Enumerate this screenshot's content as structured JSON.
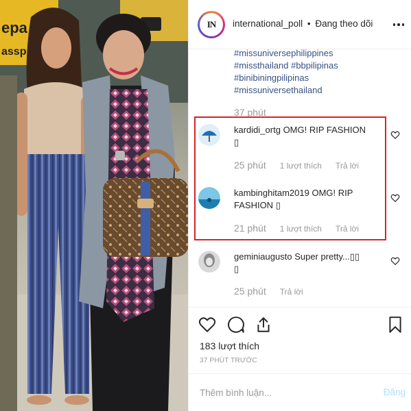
{
  "header": {
    "avatar_text": "IN",
    "username": "international_poll",
    "separator": "•",
    "follow_status": "Đang theo dõi",
    "more_icon": "more-horizontal-icon"
  },
  "caption": {
    "hashtags": [
      "#missuniversephilippines",
      "#missthailand #bbpilipinas",
      "#binibiningpilipinas",
      "#missuniversethailand"
    ],
    "time": "37 phút"
  },
  "comments": [
    {
      "username": "kardidi_ortg",
      "text": "OMG! RIP FASHION",
      "emoji_placeholder": "▯",
      "time": "25 phút",
      "likes": "1 lượt thích",
      "reply": "Trả lời",
      "avatar_color": "#1f6fb5"
    },
    {
      "username": "kambinghitam2019",
      "text": "OMG! RIP FASHION",
      "emoji_placeholder": "▯",
      "time": "21 phút",
      "likes": "1 lượt thích",
      "reply": "Trả lời",
      "avatar_color": "#3aa3d1"
    },
    {
      "username": "geminiaugusto",
      "text": "Super pretty...▯▯",
      "emoji_placeholder": "▯",
      "time": "25 phút",
      "likes": "",
      "reply": "Trả lời",
      "avatar_color": "#8a8a8a"
    }
  ],
  "actions": {
    "like_icon": "heart-icon",
    "comment_icon": "comment-icon",
    "share_icon": "share-icon",
    "save_icon": "bookmark-icon"
  },
  "likes_count": "183 lượt thích",
  "post_time": "37 PHÚT TRƯỚC",
  "comment_box": {
    "placeholder": "Thêm bình luận...",
    "post_label": "Đăng"
  },
  "colors": {
    "hashtag": "#385185",
    "highlight_border": "#d9222a",
    "post_disabled": "#b2dffc"
  }
}
